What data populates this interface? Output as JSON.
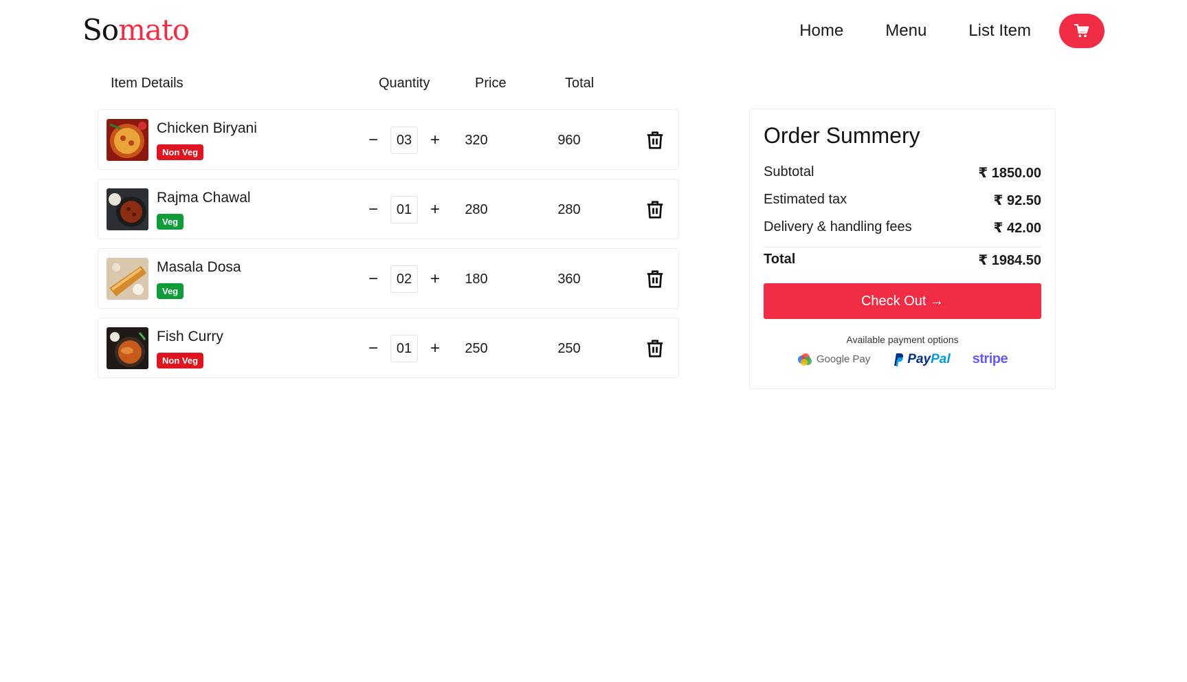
{
  "brand": {
    "logo_part1": "So",
    "logo_part2": "mato"
  },
  "nav": {
    "home": "Home",
    "menu": "Menu",
    "list_item": "List Item",
    "cart_icon": "cart-icon"
  },
  "cart": {
    "headers": {
      "item_details": "Item Details",
      "quantity": "Quantity",
      "price": "Price",
      "total": "Total"
    },
    "items": [
      {
        "name": "Chicken Biryani",
        "badge": "Non Veg",
        "qty": "03",
        "price": "320",
        "total": "960",
        "minus": "−",
        "plus": "+"
      },
      {
        "name": "Rajma Chawal",
        "badge": "Veg",
        "qty": "01",
        "price": "280",
        "total": "280",
        "minus": "−",
        "plus": "+"
      },
      {
        "name": "Masala Dosa",
        "badge": "Veg",
        "qty": "02",
        "price": "180",
        "total": "360",
        "minus": "−",
        "plus": "+"
      },
      {
        "name": "Fish Curry",
        "badge": "Non Veg",
        "qty": "01",
        "price": "250",
        "total": "250",
        "minus": "−",
        "plus": "+"
      }
    ]
  },
  "summary": {
    "title": "Order Summery",
    "subtotal_label": "Subtotal",
    "subtotal_value": "₹ 1850.00",
    "tax_label": "Estimated tax",
    "tax_value": "₹ 92.50",
    "delivery_label": "Delivery & handling fees",
    "delivery_value": "₹ 42.00",
    "total_label": "Total",
    "total_value": "₹ 1984.50",
    "checkout_label": "Check Out →",
    "payment_label": "Available payment options",
    "payment_gpay": "Google Pay",
    "payment_paypal_1": "Pay",
    "payment_paypal_2": "Pal",
    "payment_stripe": "stripe"
  },
  "colors": {
    "accent": "#f12d45",
    "nonveg": "#e0141e",
    "veg": "#0f9d3a"
  }
}
